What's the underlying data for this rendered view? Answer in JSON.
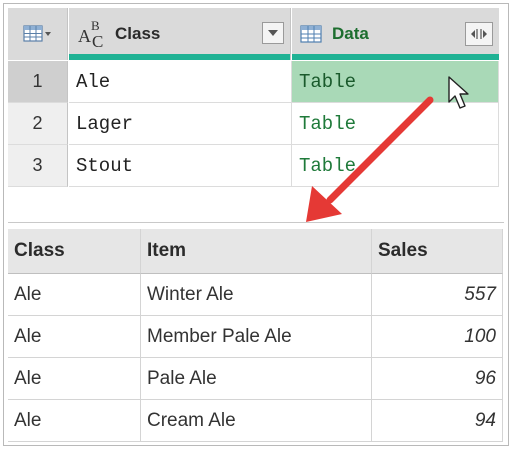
{
  "query_grid": {
    "columns": [
      {
        "type_icon": "abc-text-type-icon",
        "label": "Class",
        "control_icon": "dropdown-arrow-icon"
      },
      {
        "type_icon": "table-type-icon",
        "label": "Data",
        "control_icon": "expand-columns-icon"
      }
    ],
    "rows": [
      {
        "num": "1",
        "class": "Ale",
        "data": "Table",
        "selected": true
      },
      {
        "num": "2",
        "class": "Lager",
        "data": "Table",
        "selected": false
      },
      {
        "num": "3",
        "class": "Stout",
        "data": "Table",
        "selected": false
      }
    ],
    "type_icon_letters": {
      "a": "A",
      "b": "B",
      "c": "C"
    }
  },
  "preview_table": {
    "headers": [
      "Class",
      "Item",
      "Sales"
    ],
    "rows": [
      [
        "Ale",
        "Winter Ale",
        "557"
      ],
      [
        "Ale",
        "Member Pale Ale",
        "100"
      ],
      [
        "Ale",
        "Pale Ale",
        "96"
      ],
      [
        "Ale",
        "Cream Ale",
        "94"
      ]
    ]
  },
  "colors": {
    "header_accent": "#1fb294",
    "selected_cell": "#a9d9b7",
    "table_text": "#1f7a3a",
    "arrow": "#e53935"
  },
  "icons": [
    "table-menu-icon",
    "abc-text-type-icon",
    "dropdown-arrow-icon",
    "table-type-icon",
    "expand-columns-icon",
    "mouse-cursor-icon",
    "red-arrow-icon"
  ]
}
